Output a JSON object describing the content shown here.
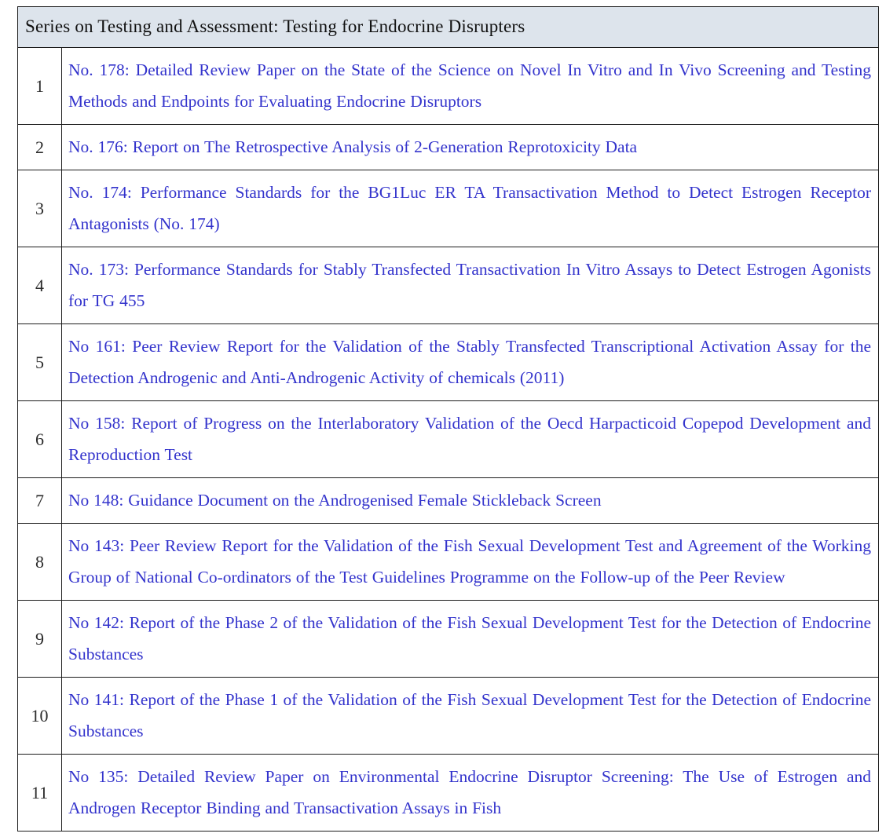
{
  "table": {
    "header": "Series on Testing and Assessment: Testing for Endocrine Disrupters",
    "columns": [
      "index",
      "title"
    ],
    "accent_color": "#3333cc",
    "header_background": "#dde4ec",
    "border_color": "#1c1c1c",
    "rows": [
      {
        "index": "1",
        "title": "No. 178: Detailed Review Paper on the State of the Science on Novel In Vitro and In Vivo Screening and Testing Methods and Endpoints for Evaluating Endocrine Disruptors"
      },
      {
        "index": "2",
        "title": "No. 176: Report on The Retrospective Analysis of 2-Generation Reprotoxicity Data"
      },
      {
        "index": "3",
        "title": "No. 174: Performance Standards for the BG1Luc ER TA Transactivation Method to Detect Estrogen Receptor Antagonists (No. 174)"
      },
      {
        "index": "4",
        "title": "No. 173: Performance Standards for Stably Transfected Transactivation In Vitro Assays to Detect Estrogen Agonists for TG 455"
      },
      {
        "index": "5",
        "title": "No 161: Peer Review Report for the Validation of the Stably Transfected Transcriptional Activation Assay for the Detection Androgenic and Anti-Androgenic Activity of chemicals (2011)"
      },
      {
        "index": "6",
        "title": "No 158: Report of Progress on the Interlaboratory Validation of the Oecd Harpacticoid Copepod Development and Reproduction Test"
      },
      {
        "index": "7",
        "title": "No 148: Guidance Document on the Androgenised Female Stickleback Screen"
      },
      {
        "index": "8",
        "title": "No 143: Peer Review Report for the Validation of the Fish Sexual Development Test and Agreement of the Working Group of National Co-ordinators of the Test Guidelines Programme on the Follow-up of the Peer Review"
      },
      {
        "index": "9",
        "title": "No 142: Report of the Phase 2 of the Validation of the Fish Sexual Development Test for the Detection of Endocrine Substances"
      },
      {
        "index": "10",
        "title": "No 141: Report of the Phase 1 of the Validation of the Fish Sexual Development Test for the Detection of Endocrine Substances"
      },
      {
        "index": "11",
        "title": "No 135: Detailed Review Paper on Environmental Endocrine Disruptor Screening: The Use of Estrogen and Androgen Receptor Binding and Transactivation Assays in Fish"
      }
    ]
  }
}
